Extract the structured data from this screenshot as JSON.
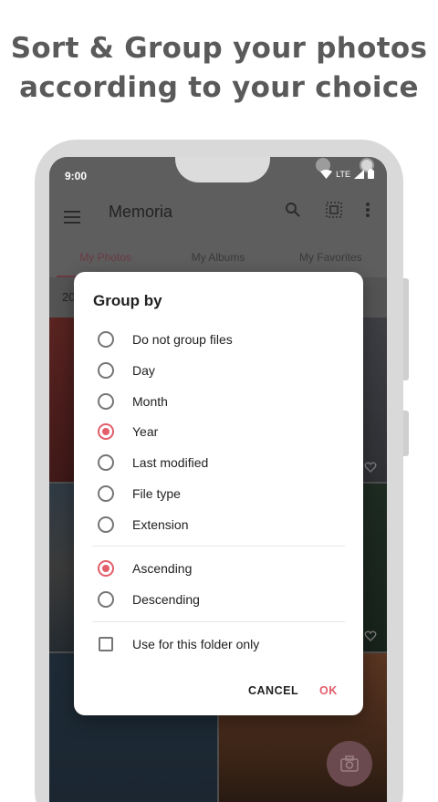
{
  "headline": {
    "line1": "Sort & Group your photos",
    "line2": "according to your choice"
  },
  "status_bar": {
    "time": "9:00",
    "network": "LTE"
  },
  "toolbar": {
    "title": "Memoria",
    "icons": [
      "menu-icon",
      "search-icon",
      "select-all-icon",
      "more-vert-icon"
    ]
  },
  "tabs": [
    {
      "label": "My Photos",
      "active": true
    },
    {
      "label": "My Albums",
      "active": false
    },
    {
      "label": "My Favorites",
      "active": false
    }
  ],
  "subheader": {
    "text": "20"
  },
  "dialog": {
    "title": "Group by",
    "group_options": [
      {
        "label": "Do not group files",
        "selected": false
      },
      {
        "label": "Day",
        "selected": false
      },
      {
        "label": "Month",
        "selected": false
      },
      {
        "label": "Year",
        "selected": true
      },
      {
        "label": "Last modified",
        "selected": false
      },
      {
        "label": "File type",
        "selected": false
      },
      {
        "label": "Extension",
        "selected": false
      }
    ],
    "order_options": [
      {
        "label": "Ascending",
        "selected": true
      },
      {
        "label": "Descending",
        "selected": false
      }
    ],
    "folder_only": {
      "label": "Use for this folder only",
      "checked": false
    },
    "cancel_label": "CANCEL",
    "ok_label": "OK"
  },
  "colors": {
    "accent": "#e35d6a",
    "headline": "#5a5a5a",
    "scrim_toolbar": "#5e5e5e",
    "phone_frame": "#d9d9d9"
  }
}
